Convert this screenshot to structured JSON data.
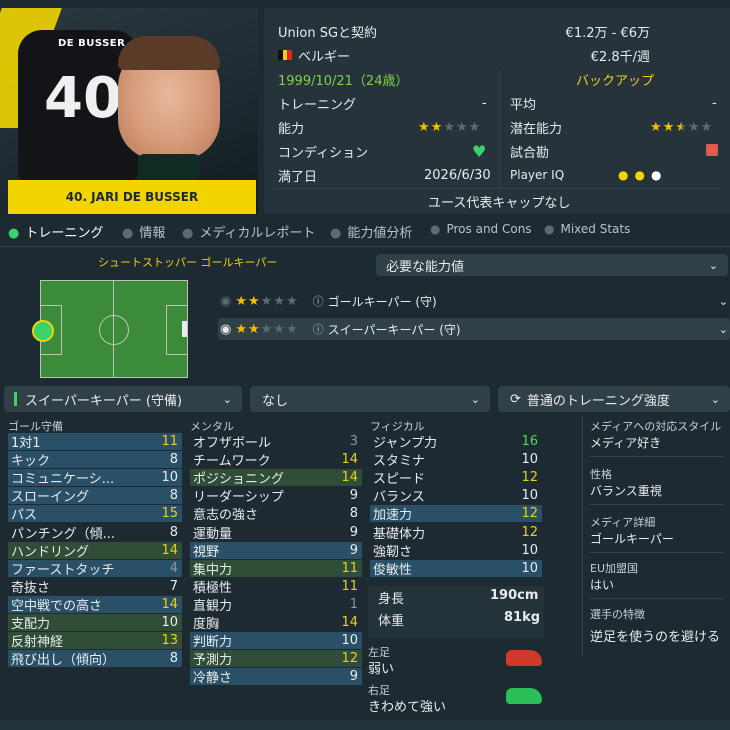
{
  "player": {
    "shirt_name": "DE BUSSER",
    "shirt_number": "40",
    "name_bar": "40. JARI DE BUSSER"
  },
  "info": {
    "contract": "Union SGと契約",
    "wage_range": "€1.2万 - €6万",
    "nationality": "ベルギー",
    "weekly": "€2.8千/週",
    "birth": "1999/10/21（24歳）",
    "role_status": "バックアップ",
    "training_label": "トレーニング",
    "training_value": "-",
    "average_label": "平均",
    "average_value": "-",
    "ability_label": "能力",
    "ability_stars": 2,
    "potential_label": "潜在能力",
    "potential_stars": 2.5,
    "condition_label": "コンディション",
    "match_sharpness_label": "試合勘",
    "expires_label": "満了日",
    "expires_value": "2026/6/30",
    "player_iq_label": "Player IQ",
    "caps_text": "ユース代表キャップなし"
  },
  "tabs": [
    {
      "label": "トレーニング",
      "active": true
    },
    {
      "label": "情報",
      "active": false
    },
    {
      "label": "メディカルレポート",
      "active": false
    },
    {
      "label": "能力値分析",
      "active": false
    },
    {
      "label": "Pros and Cons",
      "active": false
    },
    {
      "label": "Mixed Stats",
      "active": false
    }
  ],
  "roles_header": "シュートストッパー ゴールキーパー",
  "required_dropdown": "必要な能力値",
  "role_rows": [
    {
      "stars": 2,
      "label": "ゴールキーパー (守)"
    },
    {
      "stars": 2,
      "label": "スイーパーキーパー (守)"
    }
  ],
  "controls": {
    "role_select": "スイーパーキーパー (守備)",
    "focus_select": "なし",
    "intensity_select": "普通のトレーニング強度"
  },
  "columns": {
    "gk": "ゴール守備",
    "mental": "メンタル",
    "physical": "フィジカル"
  },
  "gk_attrs": [
    {
      "name": "1対1",
      "value": "11",
      "hl": "blue",
      "color": "y"
    },
    {
      "name": "キック",
      "value": "8",
      "hl": "blue",
      "color": "w"
    },
    {
      "name": "コミュニケーシ...",
      "value": "10",
      "hl": "blue",
      "color": "w"
    },
    {
      "name": "スローイング",
      "value": "8",
      "hl": "blue",
      "color": "w"
    },
    {
      "name": "パス",
      "value": "15",
      "hl": "blue",
      "color": "y"
    },
    {
      "name": "パンチング（傾...",
      "value": "8",
      "hl": "none",
      "color": "w"
    },
    {
      "name": "ハンドリング",
      "value": "14",
      "hl": "green",
      "color": "y"
    },
    {
      "name": "ファーストタッチ",
      "value": "4",
      "hl": "blue",
      "color": "gray"
    },
    {
      "name": "奇抜さ",
      "value": "7",
      "hl": "none",
      "color": "w"
    },
    {
      "name": "空中戦での高さ",
      "value": "14",
      "hl": "blue",
      "color": "y"
    },
    {
      "name": "支配力",
      "value": "10",
      "hl": "green",
      "color": "w"
    },
    {
      "name": "反射神経",
      "value": "13",
      "hl": "green",
      "color": "y"
    },
    {
      "name": "飛び出し（傾向）",
      "value": "8",
      "hl": "blue",
      "color": "w"
    }
  ],
  "mental_attrs": [
    {
      "name": "オフザボール",
      "value": "3",
      "hl": "none",
      "color": "gray"
    },
    {
      "name": "チームワーク",
      "value": "14",
      "hl": "none",
      "color": "y"
    },
    {
      "name": "ポジショニング",
      "value": "14",
      "hl": "green",
      "color": "y"
    },
    {
      "name": "リーダーシップ",
      "value": "9",
      "hl": "none",
      "color": "w"
    },
    {
      "name": "意志の強さ",
      "value": "8",
      "hl": "none",
      "color": "w"
    },
    {
      "name": "運動量",
      "value": "9",
      "hl": "none",
      "color": "w"
    },
    {
      "name": "視野",
      "value": "9",
      "hl": "blue",
      "color": "w"
    },
    {
      "name": "集中力",
      "value": "11",
      "hl": "green",
      "color": "y"
    },
    {
      "name": "積極性",
      "value": "11",
      "hl": "none",
      "color": "y"
    },
    {
      "name": "直観力",
      "value": "1",
      "hl": "none",
      "color": "gray"
    },
    {
      "name": "度胸",
      "value": "14",
      "hl": "none",
      "color": "y"
    },
    {
      "name": "判断力",
      "value": "10",
      "hl": "blue",
      "color": "w"
    },
    {
      "name": "予測力",
      "value": "12",
      "hl": "green",
      "color": "y"
    },
    {
      "name": "冷静さ",
      "value": "9",
      "hl": "blue",
      "color": "w"
    }
  ],
  "physical_attrs": [
    {
      "name": "ジャンプ力",
      "value": "16",
      "hl": "none",
      "color": "g"
    },
    {
      "name": "スタミナ",
      "value": "10",
      "hl": "none",
      "color": "w"
    },
    {
      "name": "スピード",
      "value": "12",
      "hl": "none",
      "color": "y"
    },
    {
      "name": "バランス",
      "value": "10",
      "hl": "none",
      "color": "w"
    },
    {
      "name": "加速力",
      "value": "12",
      "hl": "blue",
      "color": "y"
    },
    {
      "name": "基礎体力",
      "value": "12",
      "hl": "none",
      "color": "y"
    },
    {
      "name": "強靭さ",
      "value": "10",
      "hl": "none",
      "color": "w"
    },
    {
      "name": "俊敏性",
      "value": "10",
      "hl": "blue",
      "color": "w"
    }
  ],
  "body": {
    "height_label": "身長",
    "height_value": "190cm",
    "weight_label": "体重",
    "weight_value": "81kg",
    "left_foot_label": "左足",
    "left_foot_value": "弱い",
    "right_foot_label": "右足",
    "right_foot_value": "きわめて強い"
  },
  "side": [
    {
      "title": "メディアへの対応スタイル",
      "value": "メディア好き"
    },
    {
      "title": "性格",
      "value": "バランス重視"
    },
    {
      "title": "メディア詳細",
      "value": "ゴールキーパー"
    },
    {
      "title": "EU加盟国",
      "value": "はい"
    },
    {
      "title": "選手の特徴",
      "value": "逆足を使うのを避ける"
    }
  ],
  "colors": {
    "accent_yellow": "#f2d400",
    "good": "#4fd45f",
    "mid": "#e6d21e",
    "low": "#8a979d"
  }
}
